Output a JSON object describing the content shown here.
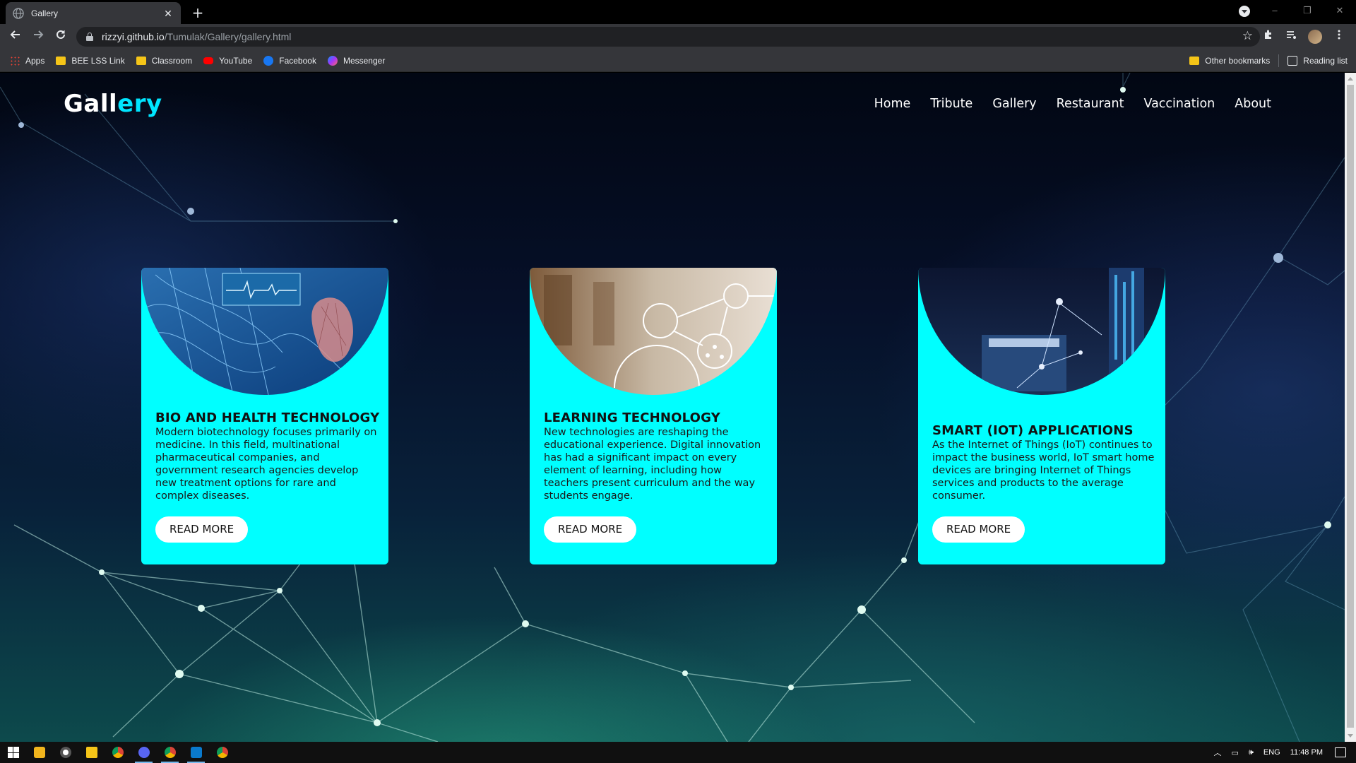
{
  "browser": {
    "tab_title": "Gallery",
    "new_tab_symbol": "+",
    "close_symbol": "✕",
    "url_host": "rizzyi.github.io",
    "url_path": "/Tumulak/Gallery/gallery.html",
    "window_controls": [
      "–",
      "❐",
      "✕"
    ]
  },
  "bookmarks": {
    "items": [
      {
        "label": "Apps",
        "icon": "apps-icon"
      },
      {
        "label": "BEE LSS Link",
        "icon": "folder-icon"
      },
      {
        "label": "Classroom",
        "icon": "folder-icon"
      },
      {
        "label": "YouTube",
        "icon": "youtube-icon"
      },
      {
        "label": "Facebook",
        "icon": "facebook-icon"
      },
      {
        "label": "Messenger",
        "icon": "messenger-icon"
      }
    ],
    "other_bookmarks": "Other bookmarks",
    "reading_list": "Reading list"
  },
  "site": {
    "logo_main": "Gall",
    "logo_accent": "ery",
    "nav": [
      "Home",
      "Tribute",
      "Gallery",
      "Restaurant",
      "Vaccination",
      "About"
    ]
  },
  "cards": [
    {
      "title": "BIO AND HEALTH TECHNOLOGY",
      "text": "Modern biotechnology focuses primarily on medicine. In this field, multinational pharmaceutical companies, and government research agencies develop new treatment options for rare and complex diseases.",
      "button": "READ MORE"
    },
    {
      "title": "LEARNING TECHNOLOGY",
      "text": "New technologies are reshaping the educational experience. Digital innovation has had a significant impact on every element of learning, including how teachers present curriculum and the way students engage.",
      "button": "READ MORE"
    },
    {
      "title": "SMART (IOT) APPLICATIONS",
      "text": "As the Internet of Things (IoT) continues to impact the business world, IoT smart home devices are bringing Internet of Things services and products to the average consumer.",
      "button": "READ MORE"
    }
  ],
  "taskbar": {
    "language": "ENG",
    "time": "11:48 PM"
  },
  "colors": {
    "accent": "#00e5ff",
    "card_bg": "#00ffff",
    "chrome_bg": "#35363a"
  }
}
